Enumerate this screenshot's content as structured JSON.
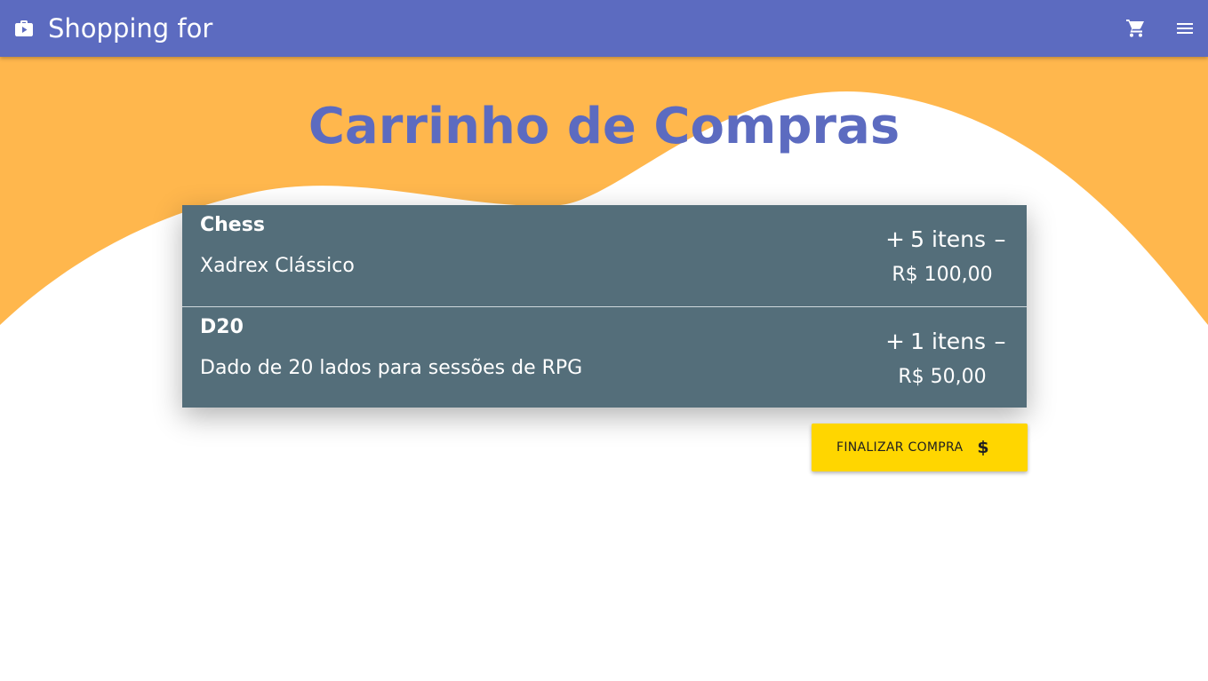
{
  "app": {
    "title": "Shopping for",
    "icon": "shopping-bag-icon"
  },
  "toolbar": {
    "cart_icon": "shopping-cart-icon",
    "menu_icon": "menu-icon"
  },
  "page": {
    "title": "Carrinho de Compras"
  },
  "cart": {
    "items": [
      {
        "name": "Chess",
        "description": "Xadrex Clássico",
        "increase_label": "+",
        "quantity_text": "5 itens",
        "decrease_label": "–",
        "price": "R$ 100,00"
      },
      {
        "name": "D20",
        "description": "Dado de 20 lados para sessões de RPG",
        "increase_label": "+",
        "quantity_text": "1 itens",
        "decrease_label": "–",
        "price": "R$ 50,00"
      }
    ]
  },
  "checkout": {
    "label": "FINALIZAR COMPRA",
    "icon_glyph": "$",
    "icon": "dollar-icon"
  },
  "colors": {
    "toolbar": "#5c6bc0",
    "accent_wave": "#ffb74d",
    "title": "#5c6bc0",
    "card": "#546e7a",
    "button": "#ffd600"
  }
}
